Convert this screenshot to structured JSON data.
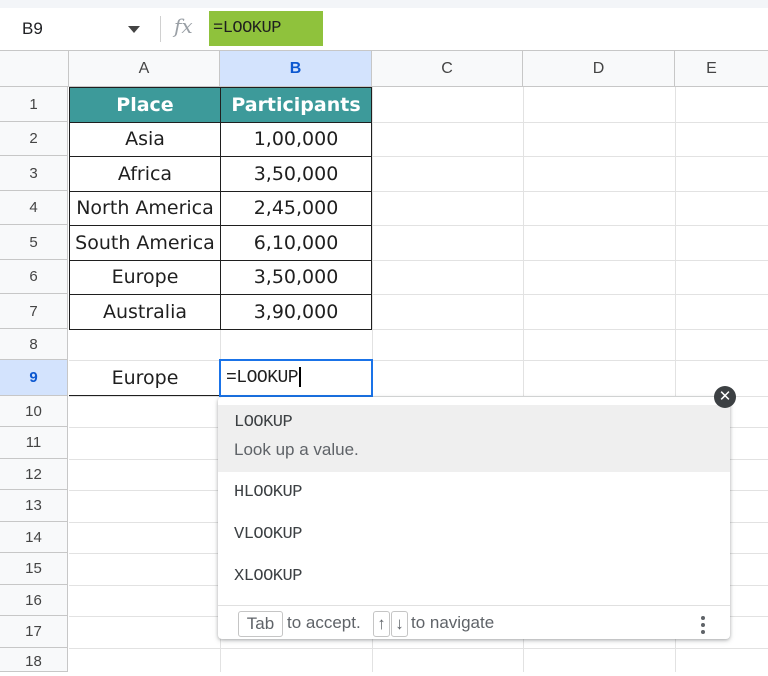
{
  "formula_bar": {
    "name_box": "B9",
    "fx_icon": "fx",
    "content": "=LOOKUP"
  },
  "columns": [
    "A",
    "B",
    "C",
    "D",
    "E"
  ],
  "rows": [
    "1",
    "2",
    "3",
    "4",
    "5",
    "6",
    "7",
    "8",
    "9",
    "10",
    "11",
    "12",
    "13",
    "14",
    "15",
    "16",
    "17",
    "18"
  ],
  "table": {
    "headers": [
      "Place",
      "Participants"
    ],
    "rows": [
      [
        "Asia",
        "1,00,000"
      ],
      [
        "Africa",
        "3,50,000"
      ],
      [
        "North America",
        "2,45,000"
      ],
      [
        "South America",
        "6,10,000"
      ],
      [
        "Europe",
        "3,50,000"
      ],
      [
        "Australia",
        "3,90,000"
      ]
    ]
  },
  "lookup_cell": {
    "value": "Europe"
  },
  "active_cell": {
    "ref": "B9",
    "value": "=LOOKUP"
  },
  "autocomplete": {
    "items": [
      {
        "name": "LOOKUP",
        "description": "Look up a value."
      },
      {
        "name": "HLOOKUP"
      },
      {
        "name": "VLOOKUP"
      },
      {
        "name": "XLOOKUP"
      }
    ],
    "footer": {
      "tab_key": "Tab",
      "accept_text": "to accept.",
      "up_key": "↑",
      "down_key": "↓",
      "navigate_text": "to navigate"
    },
    "close_icon": "close-icon",
    "more_icon": "more-vert-icon"
  },
  "colors": {
    "header_fill": "#3d9a9a",
    "formula_highlight": "#8fc23c",
    "selection_blue": "#1a73e8"
  }
}
